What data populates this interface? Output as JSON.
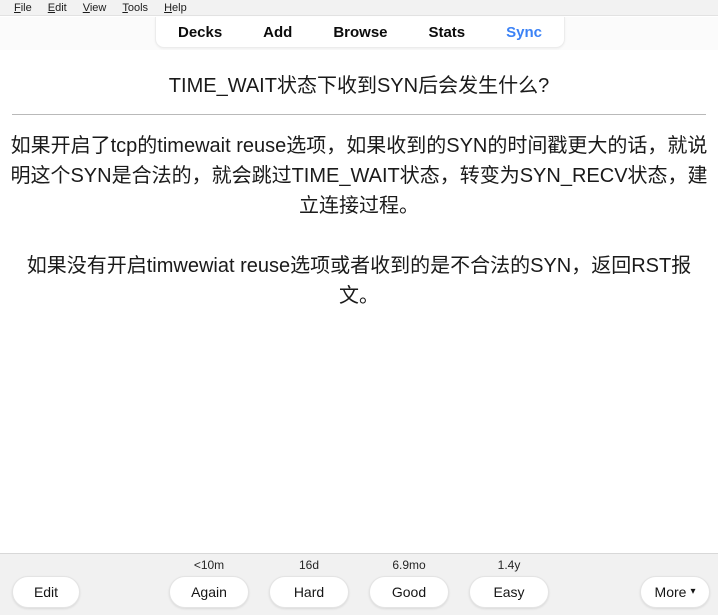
{
  "menubar": {
    "items": [
      {
        "acc": "F",
        "rest": "ile"
      },
      {
        "acc": "E",
        "rest": "dit"
      },
      {
        "acc": "V",
        "rest": "iew"
      },
      {
        "acc": "T",
        "rest": "ools"
      },
      {
        "acc": "H",
        "rest": "elp"
      }
    ]
  },
  "nav": {
    "decks": "Decks",
    "add": "Add",
    "browse": "Browse",
    "stats": "Stats",
    "sync": "Sync",
    "sync_color": "#3b82f6"
  },
  "card": {
    "question": "TIME_WAIT状态下收到SYN后会发生什么?",
    "answer_paragraph_1": "如果开启了tcp的timewait reuse选项，如果收到的SYN的时间戳更大的话，就说明这个SYN是合法的，就会跳过TIME_WAIT状态，转变为SYN_RECV状态，建立连接过程。",
    "answer_paragraph_2": "如果没有开启timwewiat reuse选项或者收到的是不合法的SYN，返回RST报文。"
  },
  "bottombar": {
    "edit_label": "Edit",
    "more_label": "More",
    "more_caret": "▾",
    "answers": [
      {
        "interval": "<10m",
        "label": "Again"
      },
      {
        "interval": "16d",
        "label": "Hard"
      },
      {
        "interval": "6.9mo",
        "label": "Good"
      },
      {
        "interval": "1.4y",
        "label": "Easy"
      }
    ]
  }
}
